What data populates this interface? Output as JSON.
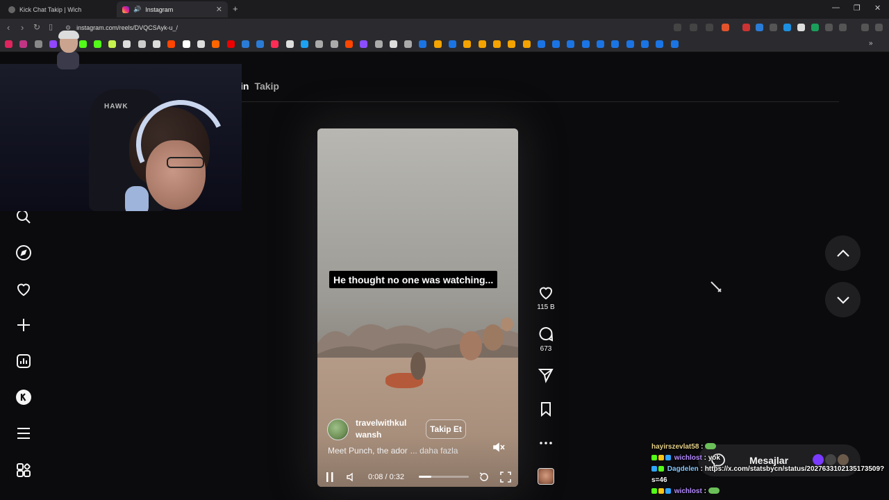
{
  "browser": {
    "tabs": [
      {
        "title": "Kick Chat Takip | Wich",
        "active": false
      },
      {
        "title": "Instagram",
        "active": true,
        "audio": true
      }
    ],
    "url": "instagram.com/reels/DVQCSAyk-u_/"
  },
  "instagram": {
    "header_tabs": [
      {
        "label": "in"
      },
      {
        "label": "Takip"
      }
    ],
    "sidenav_icons": [
      "search-icon",
      "compass-icon",
      "heart-icon",
      "plus-icon",
      "stats-icon",
      "k-icon",
      "menu-icon",
      "grid-icon"
    ],
    "reel": {
      "caption": "He thought no one was watching...",
      "username_line1": "travelwithkul",
      "username_line2": "wansh",
      "follow_label": "Takip Et",
      "description": "Meet Punch, the ador",
      "more_label": "... daha fazla",
      "time_label": "0:08 / 0:32",
      "progress": 0.25
    },
    "actions": {
      "likes": "115 B",
      "comments": "673"
    },
    "messages_label": "Mesajlar"
  },
  "chat": [
    {
      "user": "hayirszevlat58",
      "message": "",
      "emote": true
    },
    {
      "user": "wichlost",
      "message": "yok"
    },
    {
      "user": "Dagdelen",
      "message": "https://x.com/statsbycn/status/2027633102135173509?s=46"
    },
    {
      "user": "wichlost",
      "message": "",
      "emote": true
    }
  ],
  "colors": {
    "background": "#0b0b0d",
    "chat_user_gold": "#e6d18a",
    "chat_user_purple": "#b58cff",
    "chat_user_blue": "#86c8ff"
  }
}
